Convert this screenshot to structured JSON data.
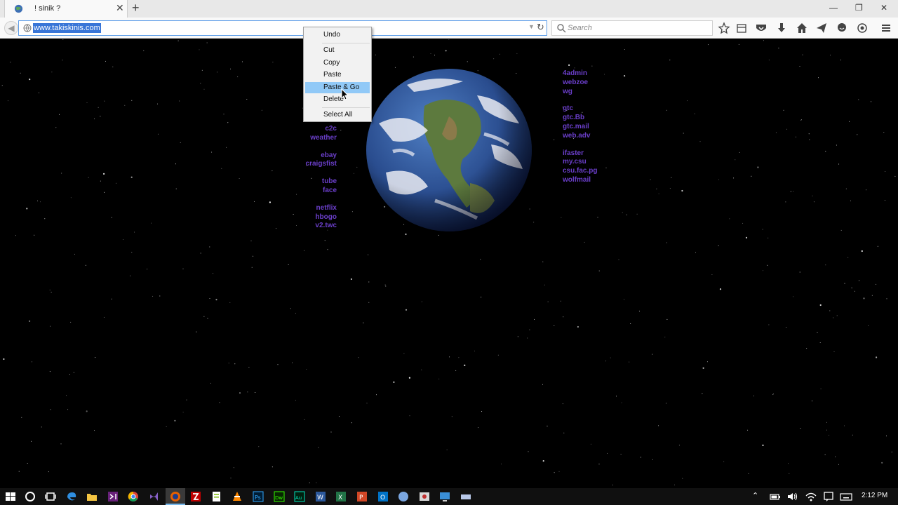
{
  "browser": {
    "tab_title": "! sinik ?",
    "url": "www.takiskinis.com",
    "search_placeholder": "Search"
  },
  "context_menu": {
    "items": [
      "Undo",
      "Cut",
      "Copy",
      "Paste",
      "Paste & Go",
      "Delete",
      "Select All"
    ],
    "highlighted": "Paste & Go"
  },
  "links_left": [
    [
      "c2c",
      "weather"
    ],
    [
      "ebay",
      "craigsfist"
    ],
    [
      "tube",
      "face"
    ],
    [
      "netflix",
      "hbogo",
      "v2.twc"
    ]
  ],
  "links_right": [
    [
      "4admin",
      "webzoe",
      "wg"
    ],
    [
      "gtc",
      "gtc.Bb",
      "gtc.mail",
      "web.adv"
    ],
    [
      "ifaster",
      "my.csu",
      "csu.fac.pg",
      "wolfmail"
    ]
  ],
  "taskbar": {
    "time": "2:12 PM"
  },
  "colors": {
    "link": "#6a3ec9",
    "menu_highlight": "#91c9f7",
    "url_selection": "#3875d7"
  }
}
